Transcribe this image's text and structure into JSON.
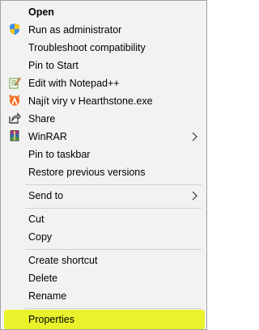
{
  "menu": {
    "items": [
      {
        "label": "Open",
        "bold": true
      },
      {
        "label": "Run as administrator",
        "icon": "uac-shield-icon"
      },
      {
        "label": "Troubleshoot compatibility"
      },
      {
        "label": "Pin to Start"
      },
      {
        "label": "Edit with Notepad++",
        "icon": "notepad-plus-plus-icon"
      },
      {
        "label": "Najít viry v Hearthstone.exe",
        "icon": "avast-icon"
      },
      {
        "label": "Share",
        "icon": "share-icon"
      },
      {
        "label": "WinRAR",
        "icon": "winrar-icon",
        "submenu": true
      },
      {
        "label": "Pin to taskbar"
      },
      {
        "label": "Restore previous versions"
      },
      {
        "label": "Send to",
        "submenu": true
      },
      {
        "label": "Cut"
      },
      {
        "label": "Copy"
      },
      {
        "label": "Create shortcut"
      },
      {
        "label": "Delete"
      },
      {
        "label": "Rename"
      },
      {
        "label": "Properties",
        "highlighted": true
      }
    ]
  },
  "colors": {
    "menu_background": "#f2f2f2",
    "highlight": "#eaf22c",
    "separator": "#d0d0d0"
  }
}
